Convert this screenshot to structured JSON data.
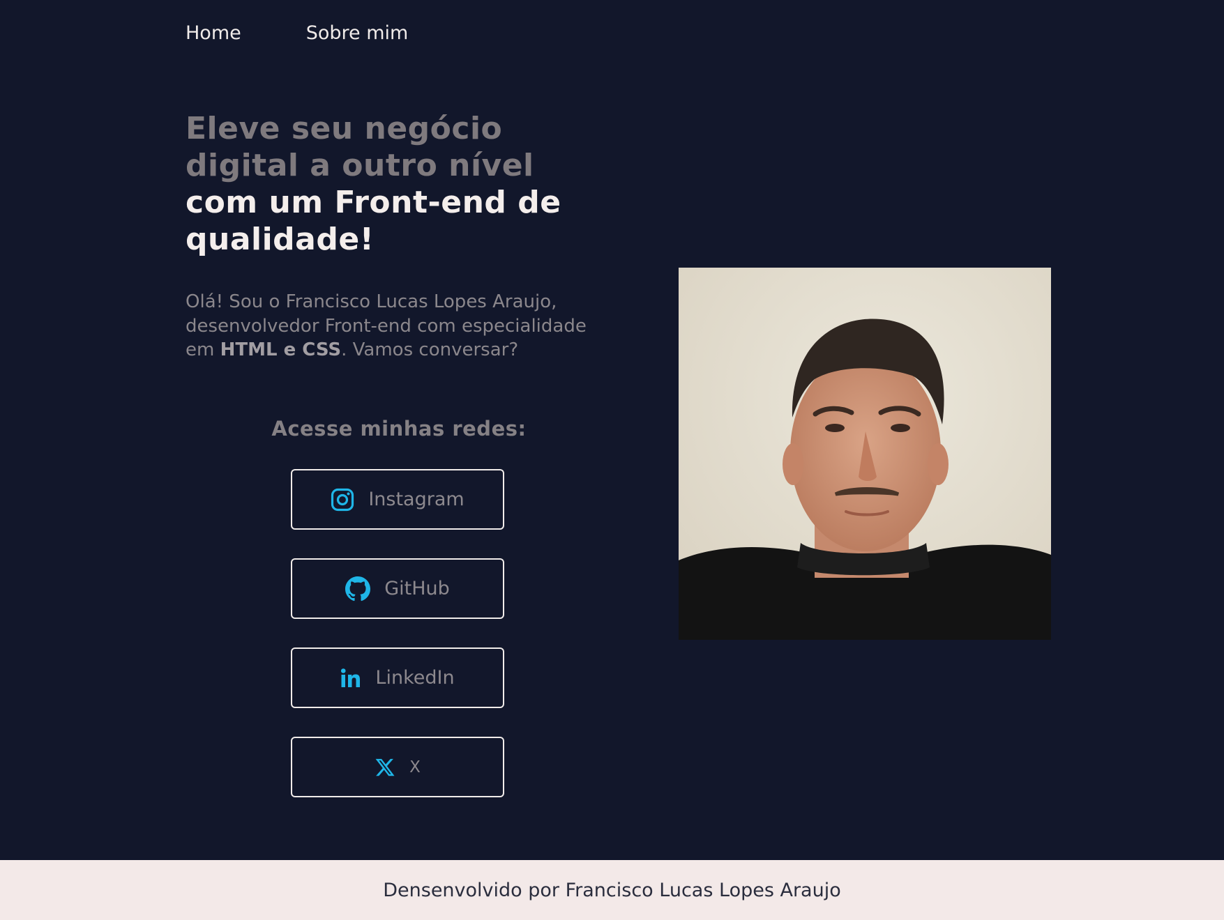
{
  "nav": {
    "items": [
      {
        "label": "Home"
      },
      {
        "label": "Sobre mim"
      }
    ]
  },
  "hero": {
    "title_line1": "Eleve seu negócio",
    "title_line2": "digital a outro nível",
    "title_line3": "com um Front-end de",
    "title_line4": "qualidade!",
    "intro_before": "Olá! Sou o Francisco Lucas Lopes Araujo, desenvolvedor Front-end com especialidade em ",
    "intro_strong": "HTML e CSS",
    "intro_after": ". Vamos conversar?"
  },
  "social": {
    "heading": "Acesse minhas redes:",
    "links": [
      {
        "label": "Instagram",
        "icon": "instagram-icon"
      },
      {
        "label": "GitHub",
        "icon": "github-icon"
      },
      {
        "label": "LinkedIn",
        "icon": "linkedin-icon"
      },
      {
        "label": "X",
        "icon": "x-icon"
      }
    ]
  },
  "colors": {
    "background": "#12172b",
    "accent_icon": "#1fb6e8",
    "footer_background": "#f3e9e8"
  },
  "footer": {
    "text": "Densenvolvido por Francisco Lucas Lopes Araujo"
  }
}
